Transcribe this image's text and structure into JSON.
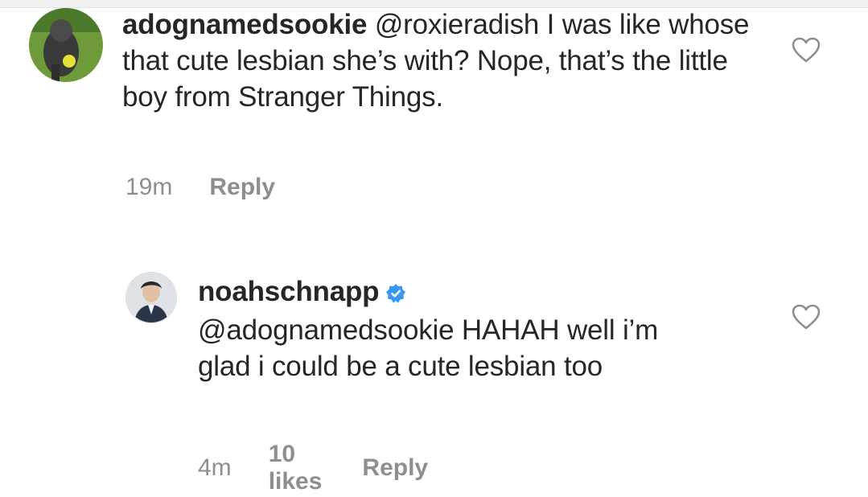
{
  "comments": [
    {
      "username": "adognamedsookie",
      "text": " @roxieradish I was like whose that cute lesbian she’s with? Nope, that’s the little boy from Stranger Things.",
      "time": "19m",
      "reply_label": "Reply",
      "avatar": "dog-avatar-icon",
      "liked": false
    },
    {
      "username": "noahschnapp",
      "verified": true,
      "text": "@adognamedsookie HAHAH well i’m glad i could be a cute lesbian too",
      "time": "4m",
      "likes": "10 likes",
      "reply_label": "Reply",
      "avatar": "person-avatar-icon",
      "liked": false
    }
  ],
  "colors": {
    "text": "#262626",
    "meta": "#8e8e8e",
    "verified": "#3897f0",
    "heart_outline": "#8e8e8e"
  }
}
